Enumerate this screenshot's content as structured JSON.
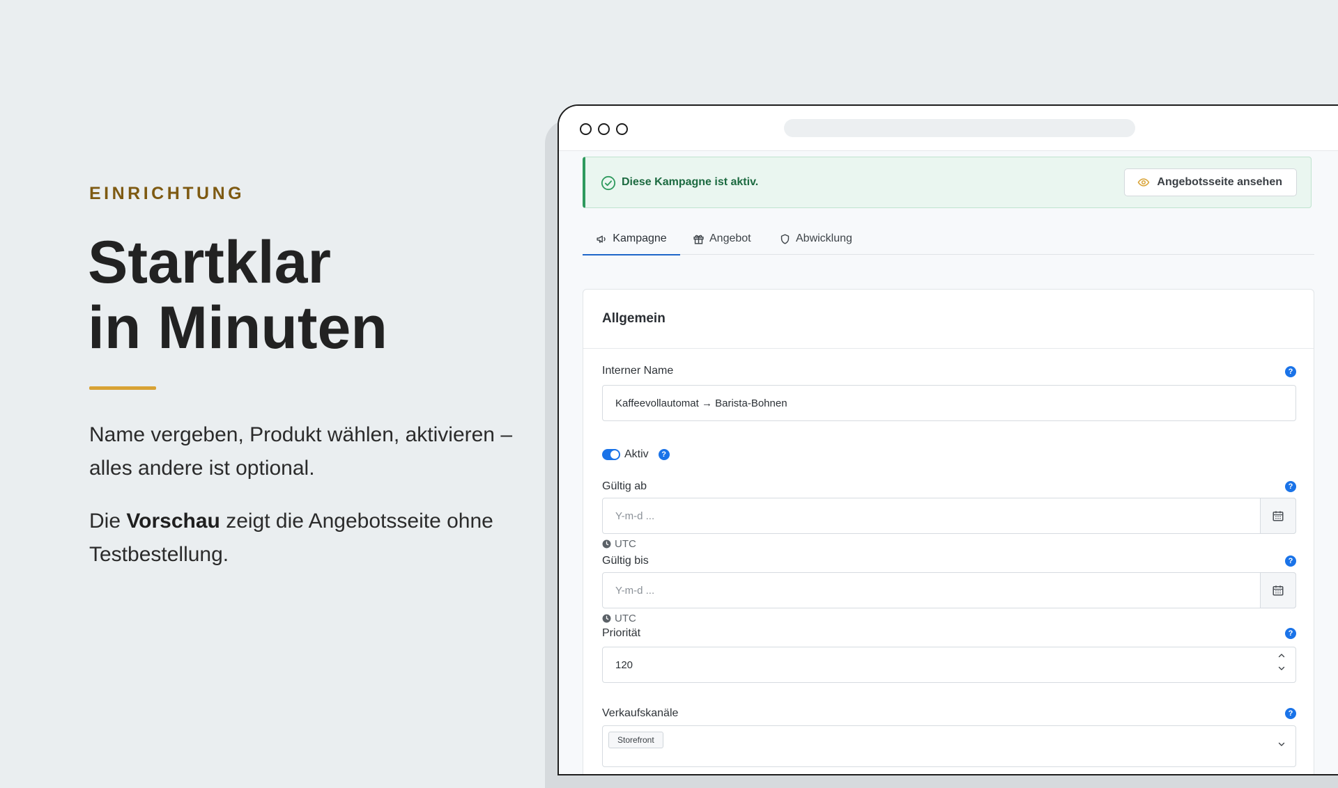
{
  "hero": {
    "eyebrow": "EINRICHTUNG",
    "title_line1": "Startklar",
    "title_line2": "in Minuten",
    "para1": "Name vergeben, Produkt wählen, aktivieren – alles andere ist optional.",
    "para2_prefix": "Die ",
    "para2_bold": "Vorschau",
    "para2_suffix": " zeigt die Angebotsseite ohne Testbestellung."
  },
  "colors": {
    "accent_gold": "#d8a234",
    "eyebrow_brown": "#7e5a12",
    "primary_blue": "#1a73e8",
    "success_green": "#2f9a5e"
  },
  "alert": {
    "text": "Diese Kampagne ist aktiv.",
    "button_label": "Angebotsseite ansehen",
    "icon": "check-circle-icon"
  },
  "tabs": [
    {
      "label": "Kampagne",
      "icon": "megaphone-icon",
      "active": true
    },
    {
      "label": "Angebot",
      "icon": "gift-icon",
      "active": false
    },
    {
      "label": "Abwicklung",
      "icon": "shield-icon",
      "active": false
    }
  ],
  "form": {
    "section_title": "Allgemein",
    "internal_name": {
      "label": "Interner Name",
      "value": "Kaffeevollautomat → Barista-Bohnen"
    },
    "active_toggle": {
      "label": "Aktiv",
      "on": true
    },
    "valid_from": {
      "label": "Gültig ab",
      "placeholder": "Y-m-d ...",
      "timezone": "UTC"
    },
    "valid_until": {
      "label": "Gültig bis",
      "placeholder": "Y-m-d ...",
      "timezone": "UTC"
    },
    "priority": {
      "label": "Priorität",
      "value": "120"
    },
    "sales_channels": {
      "label": "Verkaufskanäle",
      "chip": "Storefront"
    }
  }
}
